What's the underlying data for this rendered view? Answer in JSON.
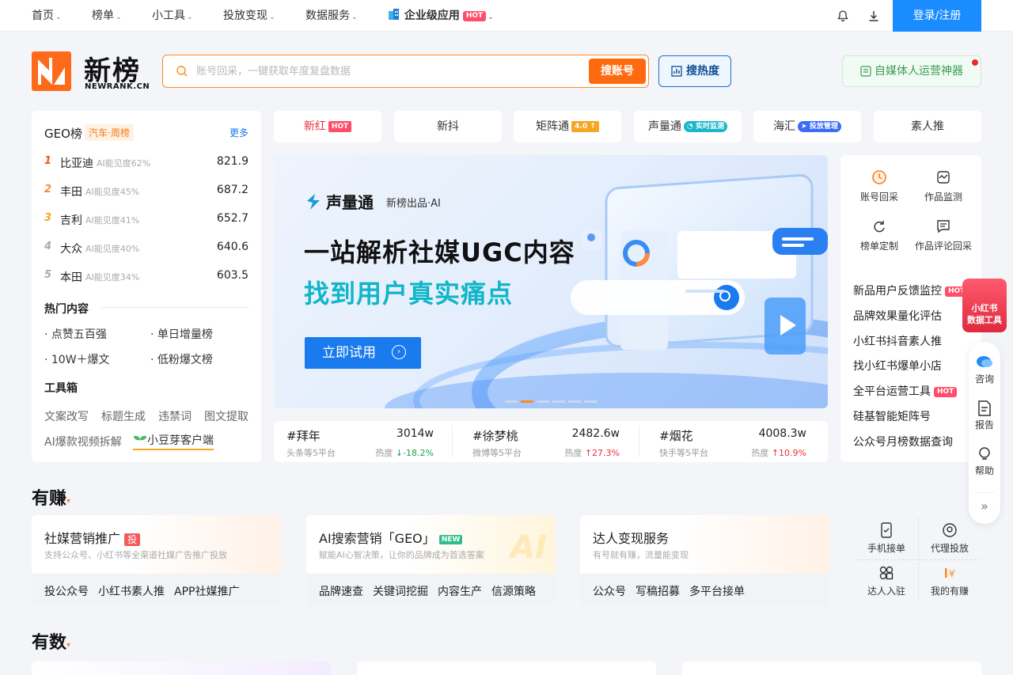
{
  "topnav": {
    "items": [
      "首页",
      "榜单",
      "小工具",
      "投放变现",
      "数据服务"
    ],
    "enterprise": "企业级应用",
    "enterprise_badge": "HOT",
    "login": "登录/注册"
  },
  "header": {
    "logo_text": "新榜",
    "logo_sub": "NEWRANK.CN",
    "search_placeholder": "账号回采，一键获取年度复盘数据",
    "search_button": "搜账号",
    "hot_button": "搜热度",
    "tool_button": "自媒体人运营神器"
  },
  "geo": {
    "title": "GEO榜",
    "tag": "汽车·周榜",
    "more": "更多",
    "rows": [
      {
        "rank": "1",
        "name": "比亚迪",
        "visibility": "AI能见度62%",
        "score": "821.9"
      },
      {
        "rank": "2",
        "name": "丰田",
        "visibility": "AI能见度45%",
        "score": "687.2"
      },
      {
        "rank": "3",
        "name": "吉利",
        "visibility": "AI能见度41%",
        "score": "652.7"
      },
      {
        "rank": "4",
        "name": "大众",
        "visibility": "AI能见度40%",
        "score": "640.6"
      },
      {
        "rank": "5",
        "name": "本田",
        "visibility": "AI能见度34%",
        "score": "603.5"
      }
    ]
  },
  "hot_content": {
    "title": "热门内容",
    "items": [
      "· 点赞五百强",
      "· 单日增量榜",
      "· 10W＋爆文",
      "· 低粉爆文榜"
    ]
  },
  "toolbox": {
    "title": "工具箱",
    "items": [
      "文案改写",
      "标题生成",
      "违禁词",
      "图文提取",
      "AI爆款视频拆解",
      "小豆芽客户端"
    ]
  },
  "platform_tabs": [
    {
      "label": "新红",
      "badge": "HOT",
      "badge_color": "#ff4d6a"
    },
    {
      "label": "新抖",
      "badge": "",
      "badge_color": ""
    },
    {
      "label": "矩阵通",
      "badge": "4.0",
      "badge_color": "#f5a623"
    },
    {
      "label": "声量通",
      "badge": "实时监测",
      "badge_color": "#18b7c9"
    },
    {
      "label": "海汇",
      "badge": "投放管理",
      "badge_color": "#3b6cf5"
    },
    {
      "label": "素人推",
      "badge": "",
      "badge_color": ""
    }
  ],
  "banner": {
    "brand": "声量通",
    "brand_sub": "新榜出品·AI",
    "headline1": "一站解析社媒UGC内容",
    "headline2": "找到用户真实痛点",
    "cta": "立即试用"
  },
  "hot_topics": [
    {
      "title": "#拜年",
      "source": "头条等5平台",
      "value": "3014w",
      "trend_label": "热度",
      "trend": "-18.2%",
      "direction": "down"
    },
    {
      "title": "#徐梦桃",
      "source": "微博等5平台",
      "value": "2482.6w",
      "trend_label": "热度",
      "trend": "27.3%",
      "direction": "up"
    },
    {
      "title": "#烟花",
      "source": "快手等5平台",
      "value": "4008.3w",
      "trend_label": "热度",
      "trend": "10.9%",
      "direction": "up"
    }
  ],
  "quick_tools": [
    {
      "label": "账号回采",
      "icon": "history-icon"
    },
    {
      "label": "作品监测",
      "icon": "monitor-icon"
    },
    {
      "label": "榜单定制",
      "icon": "refresh-icon"
    },
    {
      "label": "作品评论回采",
      "icon": "comment-icon"
    }
  ],
  "right_links": [
    {
      "label": "新品用户反馈监控",
      "hot": "HOT"
    },
    {
      "label": "品牌效果量化评估",
      "hot": ""
    },
    {
      "label": "小红书抖音素人推",
      "hot": ""
    },
    {
      "label": "找小红书爆单小店",
      "hot": ""
    },
    {
      "label": "全平台运营工具",
      "hot": "HOT"
    },
    {
      "label": "硅基智能矩阵号",
      "hot": ""
    },
    {
      "label": "公众号月榜数据查询",
      "hot": ""
    }
  ],
  "float_bar": {
    "promo": "小红书\n数据工具",
    "items": [
      "咨询",
      "报告",
      "帮助"
    ]
  },
  "section_earn": {
    "title": "有赚",
    "cards": [
      {
        "title": "社媒营销推广",
        "badge": "投",
        "desc": "支持公众号、小红书等全渠道社媒广告推广投放",
        "links": [
          "投公众号",
          "小红书素人推",
          "APP社媒推广"
        ]
      },
      {
        "title": "AI搜索营销「GEO」",
        "badge": "NEW",
        "desc": "赋能AI心智决策，让你的品牌成为首选答案",
        "links": [
          "品牌速查",
          "关键词挖掘",
          "内容生产",
          "信源策略"
        ]
      },
      {
        "title": "达人变现服务",
        "badge": "",
        "desc": "有号就有赚，流量能变现",
        "links": [
          "公众号",
          "写稿招募",
          "多平台接单"
        ]
      }
    ],
    "side": [
      "手机接单",
      "代理投放",
      "达人入驻",
      "我的有赚"
    ]
  },
  "section_data": {
    "title": "有数"
  }
}
